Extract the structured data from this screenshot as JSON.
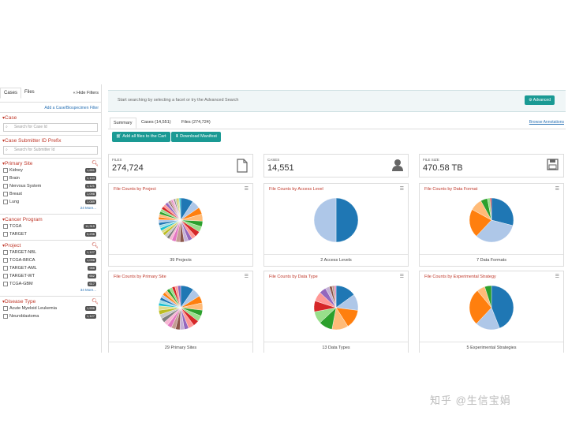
{
  "left": {
    "tabs": [
      "Cases",
      "Files"
    ],
    "hide_filters": "« Hide Filters",
    "add_link": "Add a Case/Biospecimen Filter",
    "facets": [
      {
        "title": "Case",
        "input_placeholder": "Search for Case Id",
        "items": []
      },
      {
        "title": "Case Submitter ID Prefix",
        "input_placeholder": "Search for Submitter Id",
        "items": []
      },
      {
        "title": "Primary Site",
        "search_icon": "search-icon",
        "items": [
          {
            "label": "Kidney",
            "count": "1,651"
          },
          {
            "label": "Brain",
            "count": "1,133"
          },
          {
            "label": "Nervous System",
            "count": "1,121"
          },
          {
            "label": "Breast",
            "count": "1,098"
          },
          {
            "label": "Lung",
            "count": "1,089"
          }
        ],
        "more": "24 More..."
      },
      {
        "title": "Cancer Program",
        "items": [
          {
            "label": "TCGA",
            "count": "11,315"
          },
          {
            "label": "TARGET",
            "count": "3,236"
          }
        ]
      },
      {
        "title": "Project",
        "search_icon": "search-icon",
        "items": [
          {
            "label": "TARGET-NBL",
            "count": "1,127"
          },
          {
            "label": "TCGA-BRCA",
            "count": "1,098"
          },
          {
            "label": "TARGET-AML",
            "count": "988"
          },
          {
            "label": "TARGET-WT",
            "count": "652"
          },
          {
            "label": "TCGA-GBM",
            "count": "617"
          }
        ],
        "more": "34 More..."
      },
      {
        "title": "Disease Type",
        "search_icon": "search-icon",
        "items": [
          {
            "label": "Acute Myeloid Leukemia",
            "count": "1,536"
          },
          {
            "label": "Neuroblastoma",
            "count": "1,127"
          }
        ]
      }
    ]
  },
  "search": {
    "hint": "Start searching by selecting a facet or try the Advanced Search",
    "advanced": "Advanced"
  },
  "tabs": [
    "Summary",
    "Cases (14,551)",
    "Files (274,724)"
  ],
  "browse_annotations": "Browse Annotations",
  "actions": {
    "add_all": "Add all files to the Cart",
    "download": "Download Manifest"
  },
  "stats": [
    {
      "label": "FILES",
      "value": "274,724",
      "icon": "file-icon"
    },
    {
      "label": "CASES",
      "value": "14,551",
      "icon": "user-icon"
    },
    {
      "label": "FILE SIZE",
      "value": "470.58 TB",
      "icon": "save-icon"
    }
  ],
  "colors": {
    "accent": "#1a9a94",
    "facet_title": "#c0392b",
    "link": "#2a72b5"
  },
  "cards": [
    {
      "title": "File Counts by Project",
      "footer": "39 Projects"
    },
    {
      "title": "File Counts by Access Level",
      "footer": "2 Access Levels"
    },
    {
      "title": "File Counts by Data Format",
      "footer": "7 Data Formats"
    },
    {
      "title": "File Counts by Primary Site",
      "footer": "29 Primary Sites"
    },
    {
      "title": "File Counts by Data Type",
      "footer": "13 Data Types"
    },
    {
      "title": "File Counts by Experimental Strategy",
      "footer": "5 Experimental Strategies"
    }
  ],
  "chart_data": [
    {
      "type": "pie",
      "title": "File Counts by Project",
      "values": [
        9,
        6,
        5,
        5,
        4,
        4,
        4,
        3,
        3,
        3,
        3,
        3,
        3,
        2,
        2,
        2,
        2,
        2,
        2,
        2,
        2,
        2,
        2,
        2,
        2,
        2,
        2,
        2,
        2,
        1,
        1,
        1,
        1,
        1,
        1,
        1,
        1,
        1,
        1
      ]
    },
    {
      "type": "pie",
      "title": "File Counts by Access Level",
      "values": [
        50,
        50
      ]
    },
    {
      "type": "pie",
      "title": "File Counts by Data Format",
      "values": [
        29,
        33,
        21,
        9,
        5,
        2,
        1
      ]
    },
    {
      "type": "pie",
      "title": "File Counts by Primary Site",
      "values": [
        9,
        6,
        5,
        5,
        4,
        4,
        4,
        4,
        3,
        3,
        3,
        3,
        3,
        3,
        3,
        3,
        3,
        3,
        2,
        2,
        2,
        2,
        2,
        2,
        2,
        2,
        2,
        2,
        2
      ]
    },
    {
      "type": "pie",
      "title": "File Counts by Data Type",
      "values": [
        15,
        12,
        14,
        12,
        10,
        9,
        8,
        7,
        5,
        3,
        2,
        2,
        1
      ]
    },
    {
      "type": "pie",
      "title": "File Counts by Experimental Strategy",
      "values": [
        44,
        18,
        27,
        6,
        5
      ]
    }
  ],
  "watermark": "知乎 @生信宝娟"
}
